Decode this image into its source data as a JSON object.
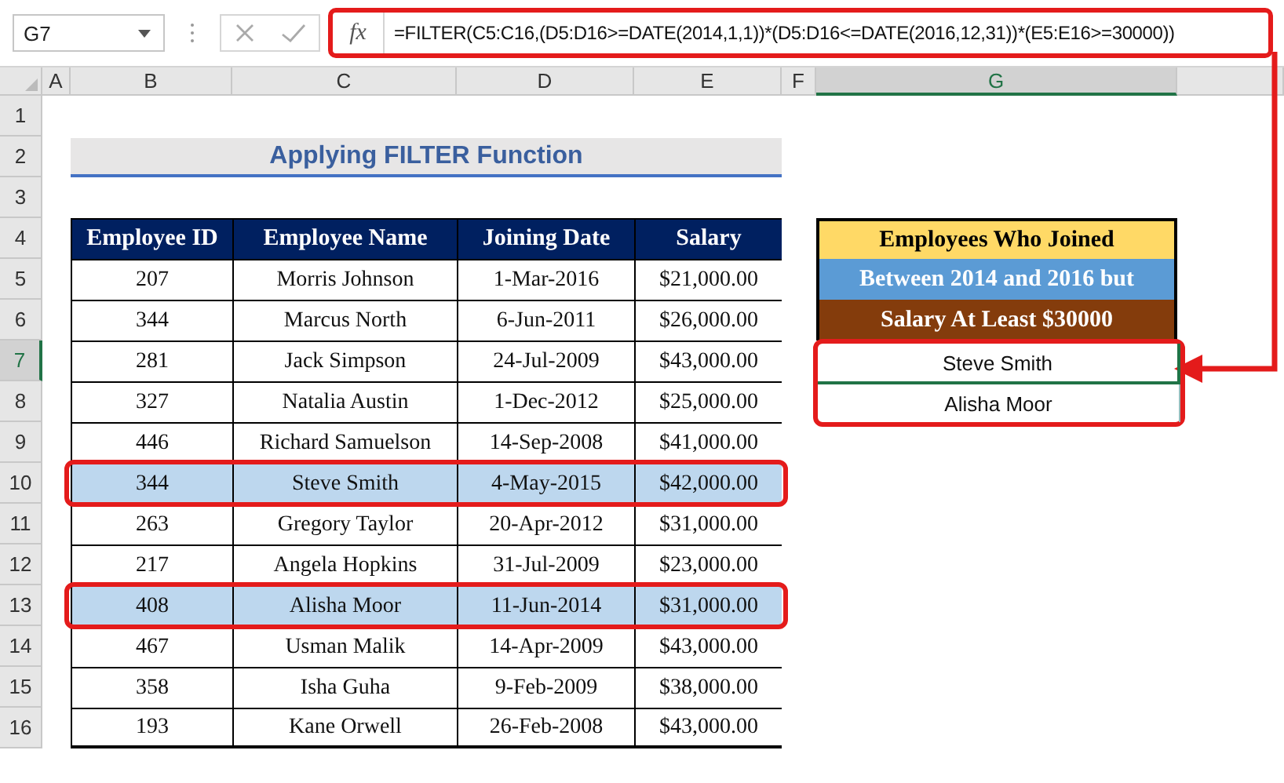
{
  "name_box": "G7",
  "function_button": "fx",
  "formula": "=FILTER(C5:C16,(D5:D16>=DATE(2014,1,1))*(D5:D16<=DATE(2016,12,31))*(E5:E16>=30000))",
  "columns": [
    {
      "label": "A",
      "selected": false
    },
    {
      "label": "B",
      "selected": false
    },
    {
      "label": "C",
      "selected": false
    },
    {
      "label": "D",
      "selected": false
    },
    {
      "label": "E",
      "selected": false
    },
    {
      "label": "F",
      "selected": false
    },
    {
      "label": "G",
      "selected": true
    }
  ],
  "rows": [
    {
      "label": "1",
      "selected": false
    },
    {
      "label": "2",
      "selected": false
    },
    {
      "label": "3",
      "selected": false
    },
    {
      "label": "4",
      "selected": false
    },
    {
      "label": "5",
      "selected": false
    },
    {
      "label": "6",
      "selected": false
    },
    {
      "label": "7",
      "selected": true
    },
    {
      "label": "8",
      "selected": false
    },
    {
      "label": "9",
      "selected": false
    },
    {
      "label": "10",
      "selected": false
    },
    {
      "label": "11",
      "selected": false
    },
    {
      "label": "12",
      "selected": false
    },
    {
      "label": "13",
      "selected": false
    },
    {
      "label": "14",
      "selected": false
    },
    {
      "label": "15",
      "selected": false
    },
    {
      "label": "16",
      "selected": false
    }
  ],
  "title": "Applying FILTER Function",
  "table": {
    "columns": [
      "Employee ID",
      "Employee Name",
      "Joining Date",
      "Salary"
    ],
    "rows": [
      {
        "cells": [
          "207",
          "Morris Johnson",
          "1-Mar-2016",
          "$21,000.00"
        ],
        "highlighted": false
      },
      {
        "cells": [
          "344",
          "Marcus North",
          "6-Jun-2011",
          "$26,000.00"
        ],
        "highlighted": false
      },
      {
        "cells": [
          "281",
          "Jack Simpson",
          "24-Jul-2009",
          "$43,000.00"
        ],
        "highlighted": false
      },
      {
        "cells": [
          "327",
          "Natalia Austin",
          "1-Dec-2012",
          "$25,000.00"
        ],
        "highlighted": false
      },
      {
        "cells": [
          "446",
          "Richard Samuelson",
          "14-Sep-2008",
          "$41,000.00"
        ],
        "highlighted": false
      },
      {
        "cells": [
          "344",
          "Steve Smith",
          "4-May-2015",
          "$42,000.00"
        ],
        "highlighted": true
      },
      {
        "cells": [
          "263",
          "Gregory Taylor",
          "20-Apr-2012",
          "$31,000.00"
        ],
        "highlighted": false
      },
      {
        "cells": [
          "217",
          "Angela Hopkins",
          "31-Jul-2009",
          "$23,000.00"
        ],
        "highlighted": false
      },
      {
        "cells": [
          "408",
          "Alisha Moor",
          "11-Jun-2014",
          "$31,000.00"
        ],
        "highlighted": true
      },
      {
        "cells": [
          "467",
          "Usman Malik",
          "14-Apr-2009",
          "$43,000.00"
        ],
        "highlighted": false
      },
      {
        "cells": [
          "358",
          "Isha Guha",
          "9-Feb-2009",
          "$38,000.00"
        ],
        "highlighted": false
      },
      {
        "cells": [
          "193",
          "Kane Orwell",
          "26-Feb-2008",
          "$43,000.00"
        ],
        "highlighted": false
      }
    ]
  },
  "result": {
    "header_lines": [
      {
        "text": "Employees Who Joined",
        "color": "#ffd966"
      },
      {
        "text": "Between 2014 and 2016 but",
        "color": "#5b9bd5"
      },
      {
        "text": "Salary At Least $30000",
        "color": "#843c0c"
      }
    ],
    "values": [
      {
        "text": "Steve Smith",
        "selected": true
      },
      {
        "text": "Alisha Moor",
        "selected": false
      }
    ]
  }
}
